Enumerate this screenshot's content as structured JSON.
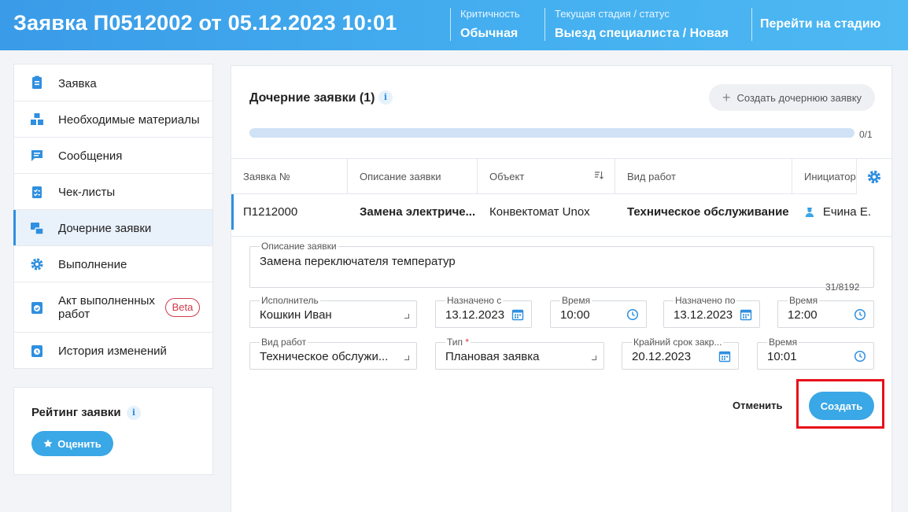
{
  "header": {
    "title": "Заявка П0512002 от 05.12.2023 10:01",
    "criticality_label": "Критичность",
    "criticality_value": "Обычная",
    "stage_label": "Текущая стадия / статус",
    "stage_value": "Выезд специалиста / Новая",
    "goto_stage": "Перейти на стадию"
  },
  "sidebar": {
    "items": [
      {
        "label": "Заявка",
        "icon": "document-icon"
      },
      {
        "label": "Необходимые материалы",
        "icon": "boxes-icon"
      },
      {
        "label": "Сообщения",
        "icon": "message-icon"
      },
      {
        "label": "Чек-листы",
        "icon": "checklist-icon"
      },
      {
        "label": "Дочерние заявки",
        "icon": "child-requests-icon",
        "active": true
      },
      {
        "label": "Выполнение",
        "icon": "gear-icon"
      },
      {
        "label": "Акт выполненных работ",
        "icon": "act-icon",
        "badge": "Beta"
      },
      {
        "label": "История изменений",
        "icon": "history-icon"
      }
    ]
  },
  "rating": {
    "title": "Рейтинг заявки",
    "button": "Оценить"
  },
  "child": {
    "title": "Дочерние заявки (1)",
    "create_button": "Создать дочернюю заявку",
    "progress_text": "0/1",
    "progress_fraction": 0
  },
  "table": {
    "headers": [
      "Заявка №",
      "Описание заявки",
      "Объект",
      "Вид работ",
      "Инициатор"
    ],
    "row": {
      "number": "П1212000",
      "description": "Замена электриче...",
      "object": "Конвектомат Unox",
      "work_type": "Техническое обслуживание",
      "initiator": "Ечина Е."
    }
  },
  "form": {
    "description_label": "Описание заявки",
    "description_value": "Замена переключателя температур",
    "counter": "31/8192",
    "executor_label": "Исполнитель",
    "executor_value": "Кошкин Иван",
    "assigned_from_label": "Назначено с",
    "assigned_from_value": "13.12.2023",
    "time1_label": "Время",
    "time1_value": "10:00",
    "assigned_to_label": "Назначено по",
    "assigned_to_value": "13.12.2023",
    "time2_label": "Время",
    "time2_value": "12:00",
    "work_type_label": "Вид работ",
    "work_type_value": "Техническое обслужи...",
    "type_label": "Тип",
    "type_required": "*",
    "type_value": "Плановая заявка",
    "deadline_label": "Крайний срок закр...",
    "deadline_value": "20.12.2023",
    "time3_label": "Время",
    "time3_value": "10:01"
  },
  "actions": {
    "cancel": "Отменить",
    "submit": "Создать"
  },
  "colors": {
    "accent": "#3aa7e6",
    "header_start": "#3a9be8",
    "highlight": "#e8101a",
    "beta": "#d23a4a"
  }
}
